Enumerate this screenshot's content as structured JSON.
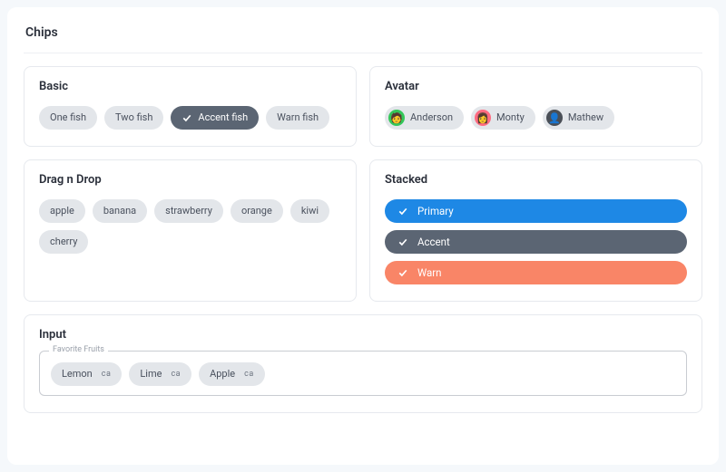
{
  "page_title": "Chips",
  "sections": {
    "basic": {
      "title": "Basic",
      "chips": [
        {
          "label": "One fish",
          "variant": "default"
        },
        {
          "label": "Two fish",
          "variant": "default"
        },
        {
          "label": "Accent fish",
          "variant": "accent",
          "checked": true
        },
        {
          "label": "Warn fish",
          "variant": "default"
        }
      ]
    },
    "avatar": {
      "title": "Avatar",
      "chips": [
        {
          "label": "Anderson",
          "avatar": "🧑",
          "avatar_bg": "#34c759"
        },
        {
          "label": "Monty",
          "avatar": "👩",
          "avatar_bg": "#ff6b81"
        },
        {
          "label": "Mathew",
          "avatar": "👤",
          "avatar_bg": "#4a4f57"
        }
      ]
    },
    "dragdrop": {
      "title": "Drag n Drop",
      "chips": [
        {
          "label": "apple"
        },
        {
          "label": "banana"
        },
        {
          "label": "strawberry"
        },
        {
          "label": "orange"
        },
        {
          "label": "kiwi"
        },
        {
          "label": "cherry"
        }
      ]
    },
    "stacked": {
      "title": "Stacked",
      "bars": [
        {
          "label": "Primary",
          "variant": "bar-primary"
        },
        {
          "label": "Accent",
          "variant": "bar-accent"
        },
        {
          "label": "Warn",
          "variant": "bar-warn"
        }
      ]
    },
    "input": {
      "title": "Input",
      "field_label": "Favorite Fruits",
      "remove_text": "ca",
      "chips": [
        {
          "label": "Lemon"
        },
        {
          "label": "Lime"
        },
        {
          "label": "Apple"
        }
      ]
    }
  }
}
